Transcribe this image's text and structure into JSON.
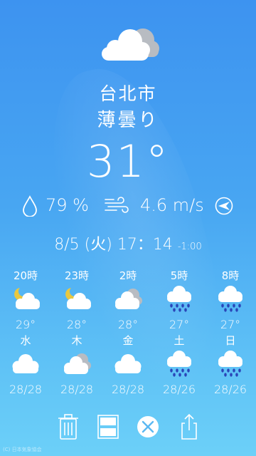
{
  "location": {
    "city": "台北市",
    "condition": "薄曇り",
    "temperature": "31°"
  },
  "stats": {
    "humidity": "79 %",
    "wind_speed": "4.6 m/s"
  },
  "datetime": {
    "date": "8/5 (火) 17：14",
    "offset": "-1:00"
  },
  "hourly": [
    {
      "time": "20時",
      "icon": "night-partly-cloudy-icon",
      "temp": "29°"
    },
    {
      "time": "23時",
      "icon": "night-partly-cloudy-icon",
      "temp": "28°"
    },
    {
      "time": "2時",
      "icon": "cloudy-icon",
      "temp": "28°"
    },
    {
      "time": "5時",
      "icon": "rain-icon",
      "temp": "27°"
    },
    {
      "time": "8時",
      "icon": "rain-icon",
      "temp": "27°"
    }
  ],
  "daily": [
    {
      "day": "水",
      "icon": "cloud-icon",
      "temp": "28/28"
    },
    {
      "day": "木",
      "icon": "cloudy-icon",
      "temp": "28/28"
    },
    {
      "day": "金",
      "icon": "cloud-icon",
      "temp": "28/28"
    },
    {
      "day": "土",
      "icon": "rain-icon",
      "temp": "28/26"
    },
    {
      "day": "日",
      "icon": "rain-icon",
      "temp": "28/26"
    }
  ],
  "toolbar": [
    "trash-icon",
    "layout-split-icon",
    "close-circle-icon",
    "share-icon"
  ],
  "copyright": "(C) 日本気象協会",
  "colors": {
    "bg_top": "#3d93f0",
    "bg_bottom": "#6cd0f8",
    "cloud_gray": "#b8bcc2",
    "rain_blue": "#2a46b8",
    "moon_yellow": "#e8c840"
  }
}
